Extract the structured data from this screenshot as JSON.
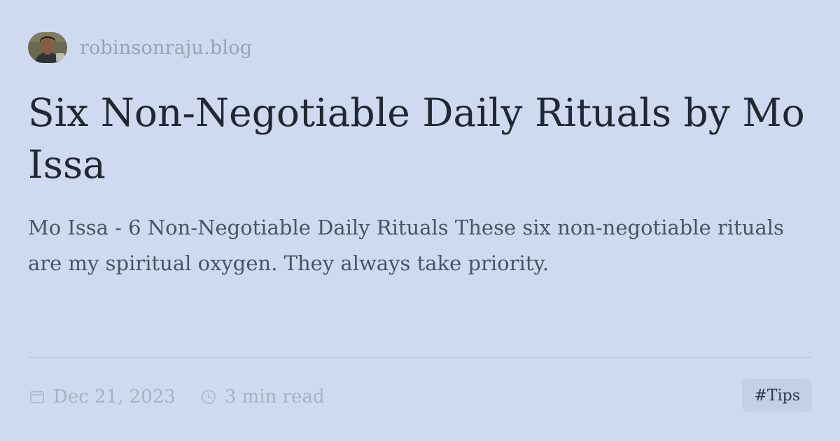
{
  "site": {
    "name": "robinsonraju.blog",
    "avatar_icon": "author-avatar"
  },
  "post": {
    "title": "Six Non-Negotiable Daily Rituals by Mo Issa",
    "description": "Mo Issa - 6 Non-Negotiable Daily Rituals These six non-negotiable rituals are my spiritual oxygen. They always take priority.",
    "date": "Dec 21, 2023",
    "read_time": "3 min read",
    "tag": "#Tips"
  },
  "icons": {
    "date": "calendar-icon",
    "read_time": "clock-icon"
  },
  "colors": {
    "background": "#cfdaf1",
    "title": "#222831",
    "muted": "#a9b1be",
    "tag_bg": "#c2d0e8"
  }
}
